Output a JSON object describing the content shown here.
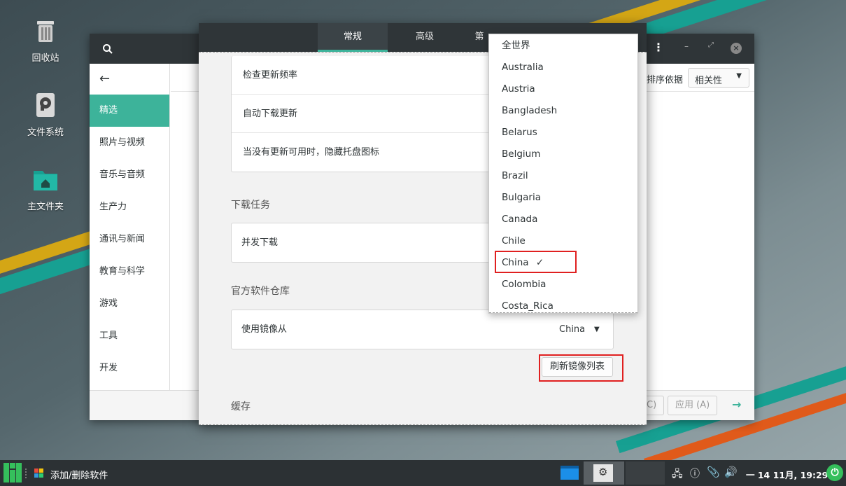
{
  "desktop": {
    "icons": [
      {
        "label": "回收站",
        "icon": "trash-icon"
      },
      {
        "label": "文件系统",
        "icon": "drive-icon"
      },
      {
        "label": "主文件夹",
        "icon": "home-folder-icon"
      }
    ]
  },
  "bg_window": {
    "sort_label": "排序依据",
    "sort_value": "相关性",
    "sidebar": [
      "精选",
      "照片与视频",
      "音乐与音频",
      "生产力",
      "通讯与新闻",
      "教育与科学",
      "游戏",
      "工具",
      "开发"
    ],
    "footer_cancel": "C)",
    "footer_apply": "应用 (A)"
  },
  "dialog": {
    "tabs": [
      "常规",
      "高级",
      "第"
    ],
    "rows_top": [
      "检查更新频率",
      "自动下载更新",
      "当没有更新可用时，隐藏托盘图标"
    ],
    "section_download": "下载任务",
    "row_concurrent": "并发下载",
    "section_repo": "官方软件仓库",
    "row_mirror": "使用镜像从",
    "mirror_value": "China",
    "refresh_button": "刷新镜像列表",
    "section_cache": "缓存"
  },
  "dropdown": {
    "options": [
      "全世界",
      "Australia",
      "Austria",
      "Bangladesh",
      "Belarus",
      "Belgium",
      "Brazil",
      "Bulgaria",
      "Canada",
      "Chile",
      "China",
      "Colombia",
      "Costa_Rica"
    ],
    "selected": "China"
  },
  "taskbar": {
    "app_label": "添加/删除软件",
    "clock": "一 14 11月, 19:29"
  },
  "colors": {
    "accent": "#3db39a",
    "highlight": "#e02020",
    "header": "#2f3538"
  }
}
